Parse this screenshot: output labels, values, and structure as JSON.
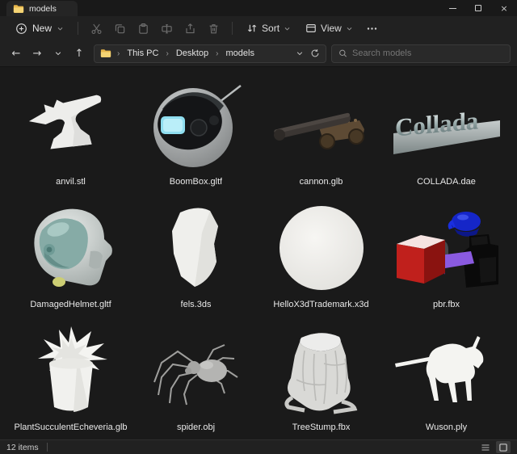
{
  "colors": {
    "folder_yellow": "#f0c94f",
    "boombox_screen_cyan": "#8fdef0",
    "pbr_cube_red": "#c0201c",
    "pbr_box_purple": "#8a5ae0",
    "pbr_teapot_blue": "#1526c8",
    "window_bg": "#1f1f1f",
    "content_bg": "#1a1a1a"
  },
  "window": {
    "tab_title": "models",
    "controls": {
      "minimize_glyph": "",
      "maximize_glyph": "",
      "close_glyph": "×"
    }
  },
  "toolbar": {
    "new_label": "New",
    "sort_label": "Sort",
    "view_label": "View"
  },
  "nav": {
    "back": "←",
    "forward": "→",
    "up": "↑"
  },
  "address_bar": {
    "crumb_this_pc": "This PC",
    "crumb_desktop": "Desktop",
    "crumb_current": "models",
    "separator": "›"
  },
  "search": {
    "placeholder": "Search models"
  },
  "files": [
    {
      "name": "anvil.stl"
    },
    {
      "name": "BoomBox.gltf"
    },
    {
      "name": "cannon.glb"
    },
    {
      "name": "COLLADA.dae",
      "thumb_text": "Collada"
    },
    {
      "name": "DamagedHelmet.gltf"
    },
    {
      "name": "fels.3ds"
    },
    {
      "name": "HelloX3dTrademark.x3d"
    },
    {
      "name": "pbr.fbx"
    },
    {
      "name": "PlantSucculentEcheveria.glb"
    },
    {
      "name": "spider.obj"
    },
    {
      "name": "TreeStump.fbx"
    },
    {
      "name": "Wuson.ply"
    }
  ],
  "status_bar": {
    "items_count": "12 items"
  }
}
